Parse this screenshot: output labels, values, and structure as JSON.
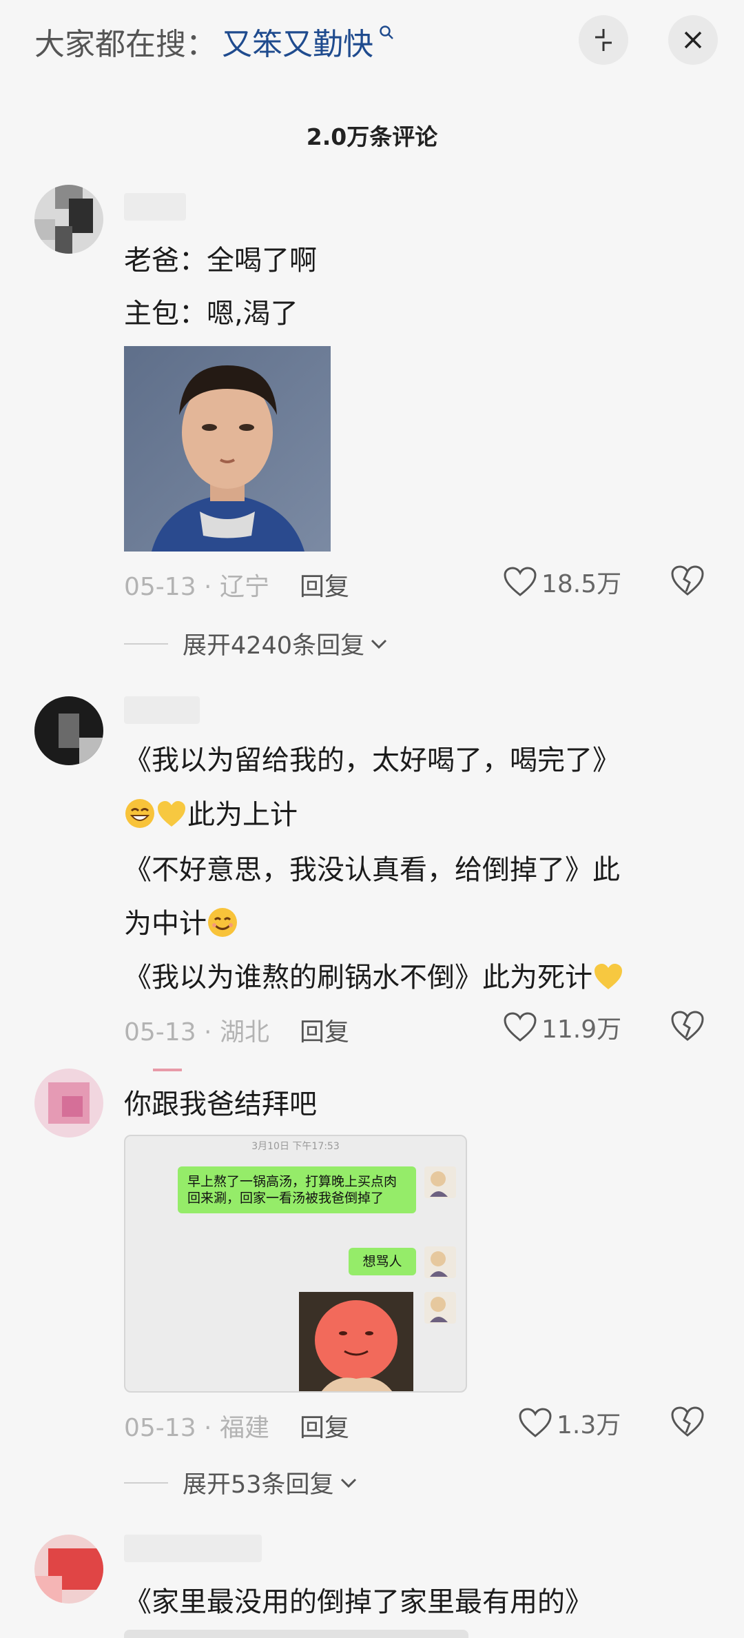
{
  "search": {
    "prefix": "大家都在搜：",
    "term": "又笨又勤快"
  },
  "header": {
    "comment_count": "2.0万条评论"
  },
  "comments": [
    {
      "lines": [
        "老爸：全喝了啊",
        "主包：嗯,渴了"
      ],
      "date_location": "05-13 · 辽宁",
      "reply_label": "回复",
      "likes": "18.5万",
      "expand": "展开4240条回复"
    },
    {
      "lines": [
        "《我以为留给我的，太好喝了，喝完了》",
        "此为上计",
        "《不好意思，我没认真看，给倒掉了》此",
        "为中计",
        "《我以为谁熬的刷锅水不倒》此为死计"
      ],
      "date_location": "05-13 · 湖北",
      "reply_label": "回复",
      "likes": "11.9万"
    },
    {
      "lines": [
        "你跟我爸结拜吧"
      ],
      "chat": {
        "time": "3月10日 下午17:53",
        "msg1": "早上熬了一锅高汤，打算晚上买点肉回来涮，回家一看汤被我爸倒掉了",
        "msg2": "想骂人"
      },
      "date_location": "05-13 · 福建",
      "reply_label": "回复",
      "likes": "1.3万",
      "expand": "展开53条回复"
    },
    {
      "lines": [
        "《家里最没用的倒掉了家里最有用的》"
      ]
    }
  ],
  "colors": {
    "search_term": "#1f4b8e",
    "chat_bubble": "#95ec69",
    "background": "#f6f6f6"
  }
}
